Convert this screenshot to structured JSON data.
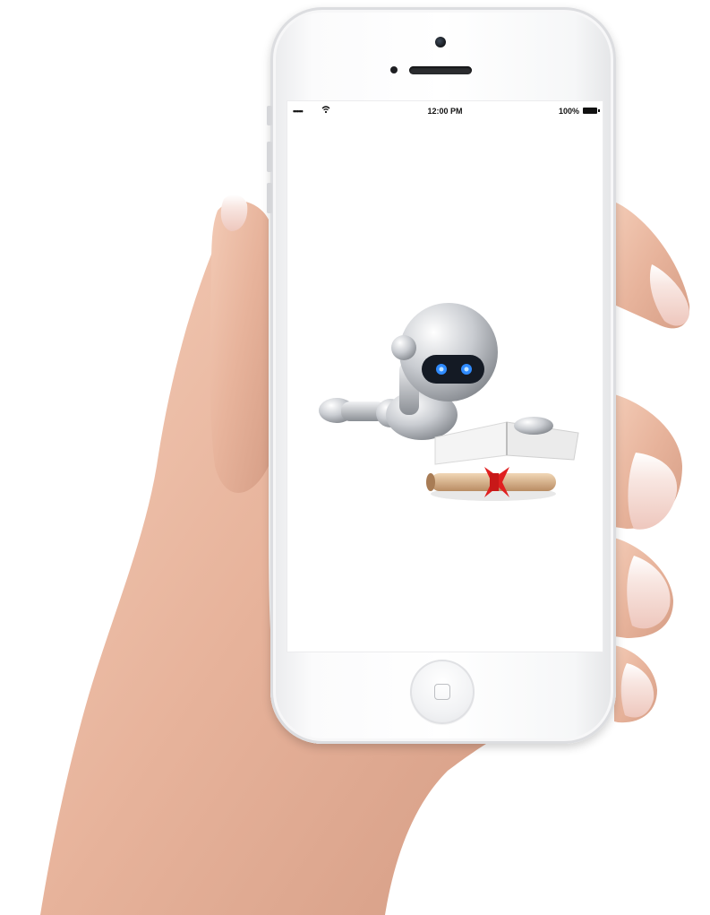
{
  "status_bar": {
    "signal": "•••••",
    "time": "12:00 PM",
    "battery": "100%"
  },
  "colors": {
    "skin": "#e9b9a0",
    "nail": "#f7e4df",
    "robot_eyes": "#2f8bff",
    "ribbon": "#e02020"
  },
  "icons": [
    "wifi-icon",
    "battery-icon",
    "home-button-square-icon"
  ]
}
